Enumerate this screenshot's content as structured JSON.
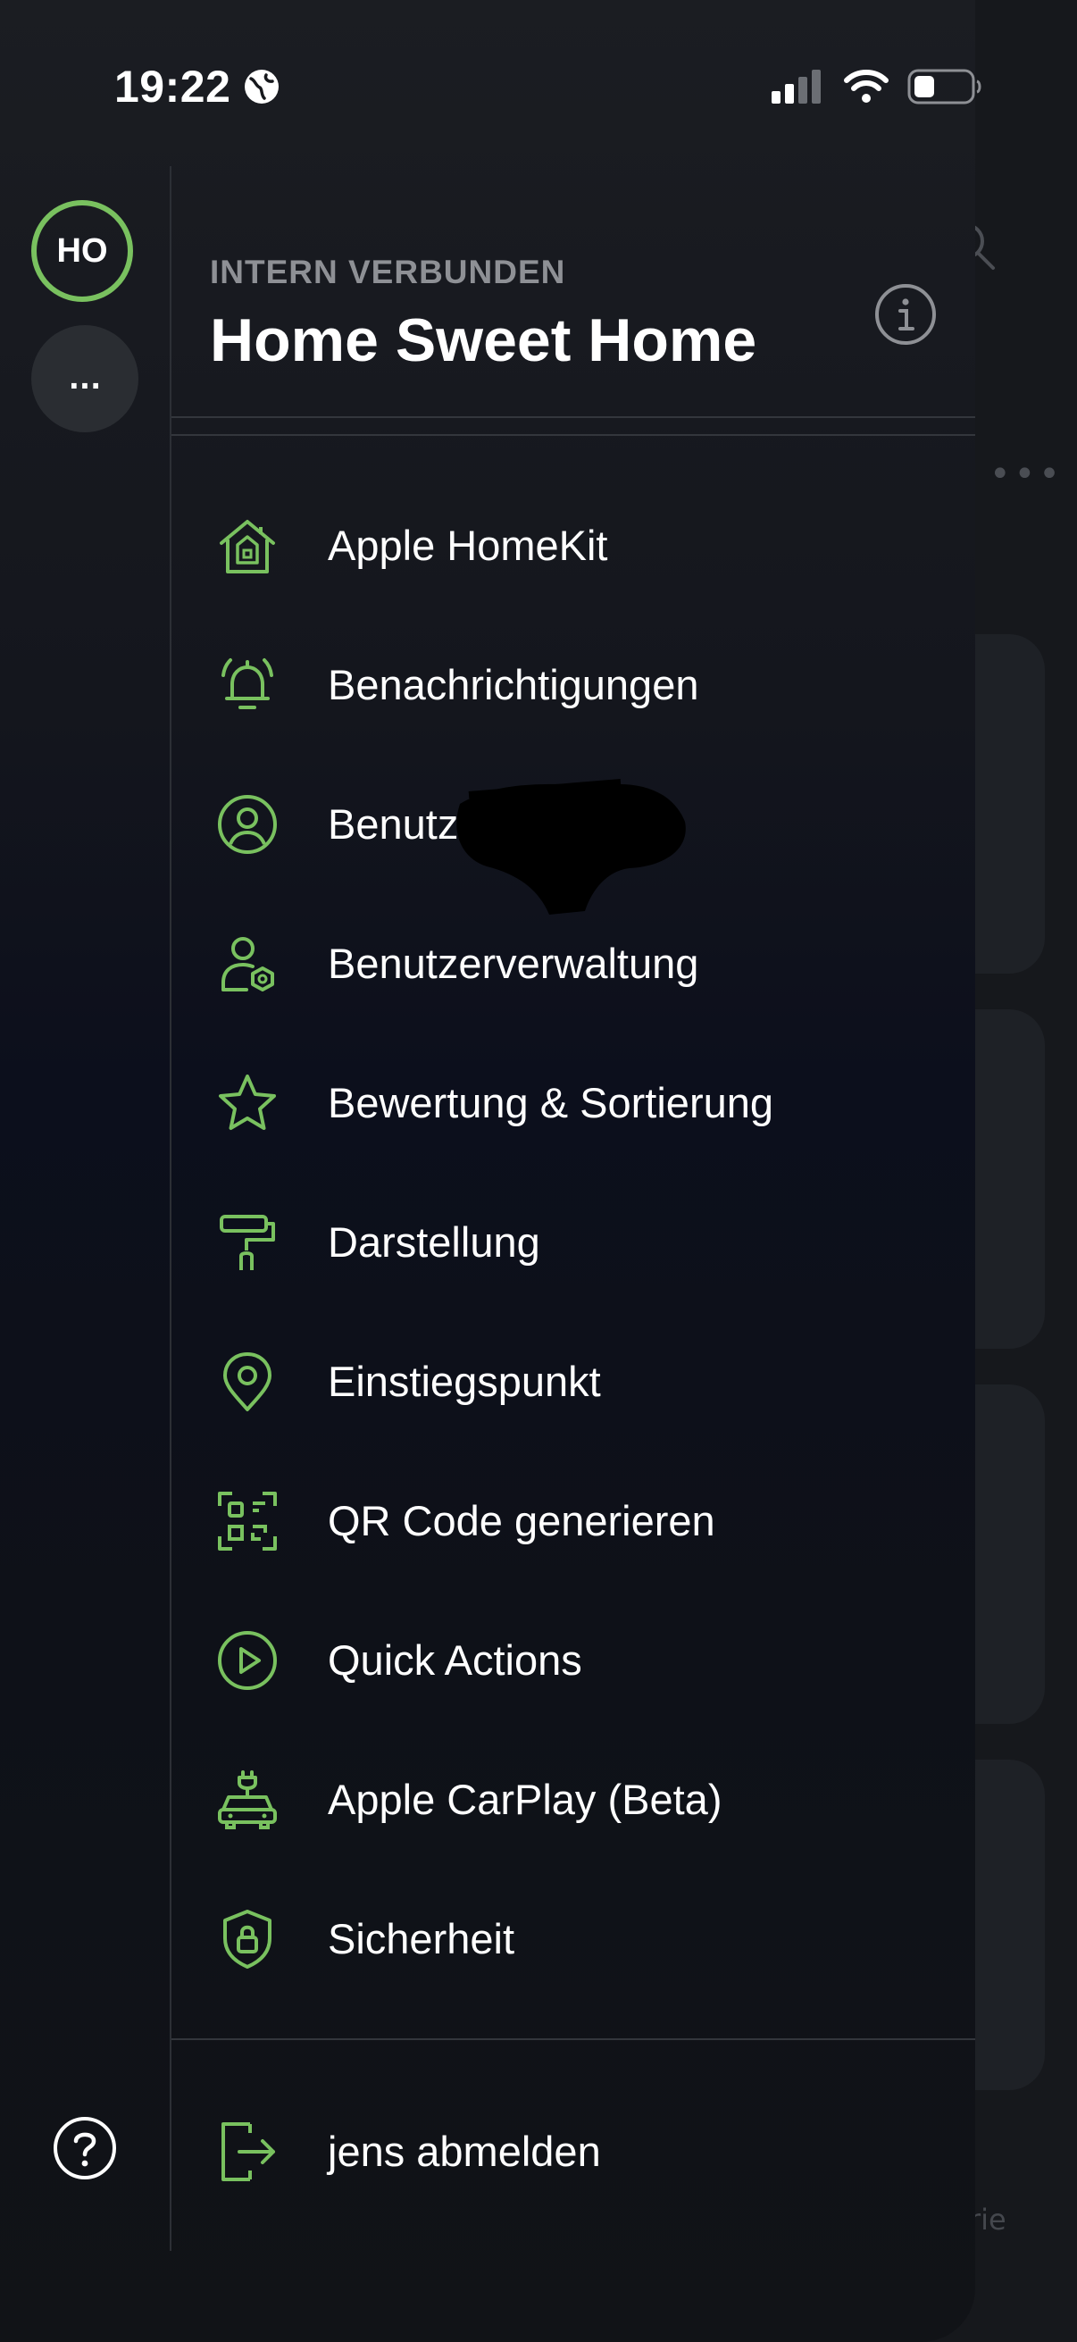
{
  "status_bar": {
    "time": "19:22"
  },
  "background": {
    "visible_fragment": "rie"
  },
  "rail": {
    "avatar_initials": "HO",
    "more_label": "..."
  },
  "header": {
    "subtitle": "INTERN VERBUNDEN",
    "title": "Home Sweet Home"
  },
  "menu": {
    "items": [
      {
        "label": "Apple HomeKit",
        "icon": "home-icon"
      },
      {
        "label": "Benachrichtigungen",
        "icon": "bell-icon"
      },
      {
        "label": "Benutz",
        "icon": "user-circle-icon"
      },
      {
        "label": "Benutzerverwaltung",
        "icon": "user-settings-icon"
      },
      {
        "label": "Bewertung & Sortierung",
        "icon": "star-icon"
      },
      {
        "label": "Darstellung",
        "icon": "paint-roller-icon"
      },
      {
        "label": "Einstiegspunkt",
        "icon": "location-pin-icon"
      },
      {
        "label": "QR Code generieren",
        "icon": "qr-scan-icon"
      },
      {
        "label": "Quick Actions",
        "icon": "play-circle-icon"
      },
      {
        "label": "Apple CarPlay (Beta)",
        "icon": "car-plug-icon"
      },
      {
        "label": "Sicherheit",
        "icon": "shield-lock-icon"
      }
    ],
    "logout_label": "jens abmelden"
  },
  "colors": {
    "accent": "#79c15f",
    "text": "#ffffff",
    "subtitle": "#8e9095"
  }
}
